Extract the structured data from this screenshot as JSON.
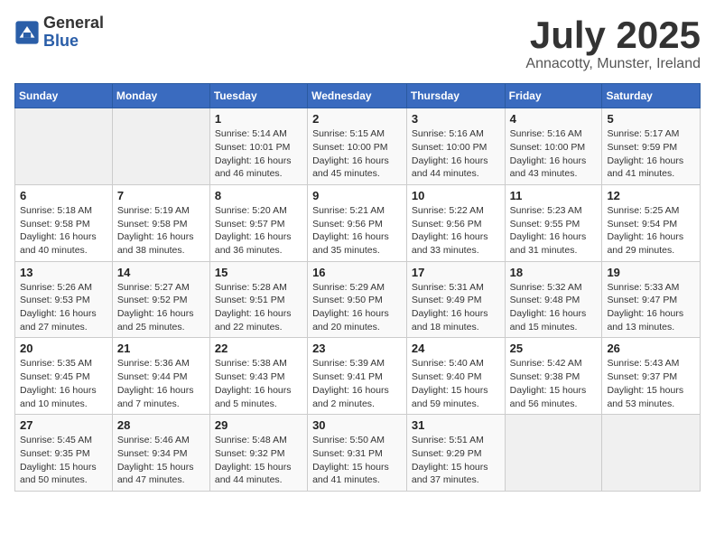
{
  "logo": {
    "general": "General",
    "blue": "Blue"
  },
  "header": {
    "month": "July 2025",
    "location": "Annacotty, Munster, Ireland"
  },
  "weekdays": [
    "Sunday",
    "Monday",
    "Tuesday",
    "Wednesday",
    "Thursday",
    "Friday",
    "Saturday"
  ],
  "weeks": [
    [
      {
        "day": "",
        "detail": ""
      },
      {
        "day": "",
        "detail": ""
      },
      {
        "day": "1",
        "detail": "Sunrise: 5:14 AM\nSunset: 10:01 PM\nDaylight: 16 hours\nand 46 minutes."
      },
      {
        "day": "2",
        "detail": "Sunrise: 5:15 AM\nSunset: 10:00 PM\nDaylight: 16 hours\nand 45 minutes."
      },
      {
        "day": "3",
        "detail": "Sunrise: 5:16 AM\nSunset: 10:00 PM\nDaylight: 16 hours\nand 44 minutes."
      },
      {
        "day": "4",
        "detail": "Sunrise: 5:16 AM\nSunset: 10:00 PM\nDaylight: 16 hours\nand 43 minutes."
      },
      {
        "day": "5",
        "detail": "Sunrise: 5:17 AM\nSunset: 9:59 PM\nDaylight: 16 hours\nand 41 minutes."
      }
    ],
    [
      {
        "day": "6",
        "detail": "Sunrise: 5:18 AM\nSunset: 9:58 PM\nDaylight: 16 hours\nand 40 minutes."
      },
      {
        "day": "7",
        "detail": "Sunrise: 5:19 AM\nSunset: 9:58 PM\nDaylight: 16 hours\nand 38 minutes."
      },
      {
        "day": "8",
        "detail": "Sunrise: 5:20 AM\nSunset: 9:57 PM\nDaylight: 16 hours\nand 36 minutes."
      },
      {
        "day": "9",
        "detail": "Sunrise: 5:21 AM\nSunset: 9:56 PM\nDaylight: 16 hours\nand 35 minutes."
      },
      {
        "day": "10",
        "detail": "Sunrise: 5:22 AM\nSunset: 9:56 PM\nDaylight: 16 hours\nand 33 minutes."
      },
      {
        "day": "11",
        "detail": "Sunrise: 5:23 AM\nSunset: 9:55 PM\nDaylight: 16 hours\nand 31 minutes."
      },
      {
        "day": "12",
        "detail": "Sunrise: 5:25 AM\nSunset: 9:54 PM\nDaylight: 16 hours\nand 29 minutes."
      }
    ],
    [
      {
        "day": "13",
        "detail": "Sunrise: 5:26 AM\nSunset: 9:53 PM\nDaylight: 16 hours\nand 27 minutes."
      },
      {
        "day": "14",
        "detail": "Sunrise: 5:27 AM\nSunset: 9:52 PM\nDaylight: 16 hours\nand 25 minutes."
      },
      {
        "day": "15",
        "detail": "Sunrise: 5:28 AM\nSunset: 9:51 PM\nDaylight: 16 hours\nand 22 minutes."
      },
      {
        "day": "16",
        "detail": "Sunrise: 5:29 AM\nSunset: 9:50 PM\nDaylight: 16 hours\nand 20 minutes."
      },
      {
        "day": "17",
        "detail": "Sunrise: 5:31 AM\nSunset: 9:49 PM\nDaylight: 16 hours\nand 18 minutes."
      },
      {
        "day": "18",
        "detail": "Sunrise: 5:32 AM\nSunset: 9:48 PM\nDaylight: 16 hours\nand 15 minutes."
      },
      {
        "day": "19",
        "detail": "Sunrise: 5:33 AM\nSunset: 9:47 PM\nDaylight: 16 hours\nand 13 minutes."
      }
    ],
    [
      {
        "day": "20",
        "detail": "Sunrise: 5:35 AM\nSunset: 9:45 PM\nDaylight: 16 hours\nand 10 minutes."
      },
      {
        "day": "21",
        "detail": "Sunrise: 5:36 AM\nSunset: 9:44 PM\nDaylight: 16 hours\nand 7 minutes."
      },
      {
        "day": "22",
        "detail": "Sunrise: 5:38 AM\nSunset: 9:43 PM\nDaylight: 16 hours\nand 5 minutes."
      },
      {
        "day": "23",
        "detail": "Sunrise: 5:39 AM\nSunset: 9:41 PM\nDaylight: 16 hours\nand 2 minutes."
      },
      {
        "day": "24",
        "detail": "Sunrise: 5:40 AM\nSunset: 9:40 PM\nDaylight: 15 hours\nand 59 minutes."
      },
      {
        "day": "25",
        "detail": "Sunrise: 5:42 AM\nSunset: 9:38 PM\nDaylight: 15 hours\nand 56 minutes."
      },
      {
        "day": "26",
        "detail": "Sunrise: 5:43 AM\nSunset: 9:37 PM\nDaylight: 15 hours\nand 53 minutes."
      }
    ],
    [
      {
        "day": "27",
        "detail": "Sunrise: 5:45 AM\nSunset: 9:35 PM\nDaylight: 15 hours\nand 50 minutes."
      },
      {
        "day": "28",
        "detail": "Sunrise: 5:46 AM\nSunset: 9:34 PM\nDaylight: 15 hours\nand 47 minutes."
      },
      {
        "day": "29",
        "detail": "Sunrise: 5:48 AM\nSunset: 9:32 PM\nDaylight: 15 hours\nand 44 minutes."
      },
      {
        "day": "30",
        "detail": "Sunrise: 5:50 AM\nSunset: 9:31 PM\nDaylight: 15 hours\nand 41 minutes."
      },
      {
        "day": "31",
        "detail": "Sunrise: 5:51 AM\nSunset: 9:29 PM\nDaylight: 15 hours\nand 37 minutes."
      },
      {
        "day": "",
        "detail": ""
      },
      {
        "day": "",
        "detail": ""
      }
    ]
  ]
}
